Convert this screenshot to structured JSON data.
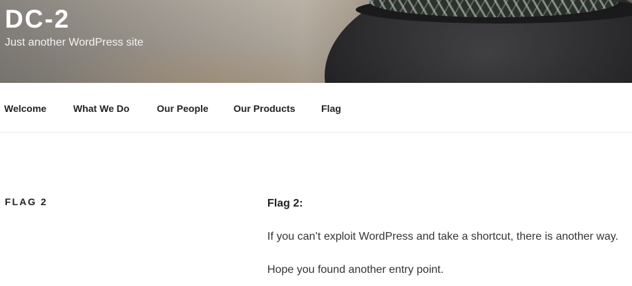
{
  "header": {
    "site_title": "DC-2",
    "tagline": "Just another WordPress site"
  },
  "nav": {
    "items": [
      {
        "label": "Welcome"
      },
      {
        "label": "What We Do"
      },
      {
        "label": "Our People"
      },
      {
        "label": "Our Products"
      },
      {
        "label": "Flag"
      }
    ]
  },
  "page": {
    "title": "FLAG 2",
    "content": {
      "heading": "Flag 2:",
      "paragraphs": [
        "If you can’t exploit WordPress and take a shortcut, there is another way.",
        "Hope you found another entry point."
      ]
    }
  },
  "colors": {
    "text_dark": "#222222",
    "text_body": "#333333",
    "header_text": "#ffffff"
  }
}
